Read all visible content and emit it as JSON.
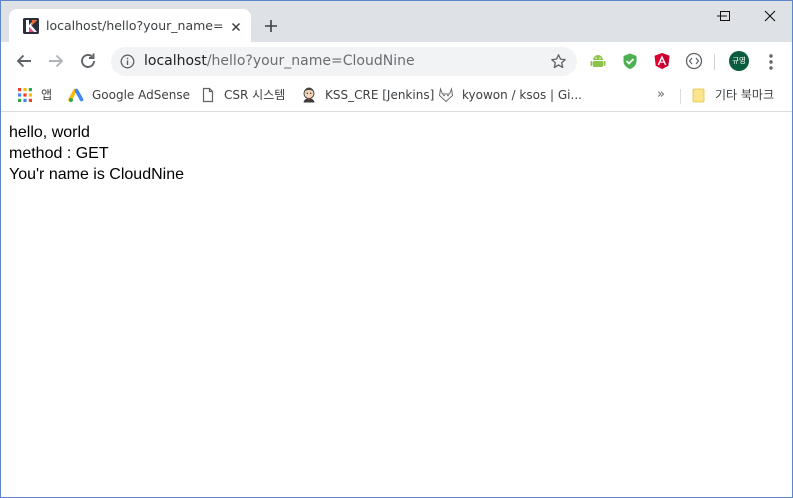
{
  "tab": {
    "title": "localhost/hello?your_name=CloudNine",
    "favicon": "kotlin-k-favicon"
  },
  "toolbar": {
    "url_host": "localhost",
    "url_path": "/hello?your_name=CloudNine",
    "profile_initials": "규영"
  },
  "bookmarks": {
    "items": [
      {
        "label": "앱",
        "icon": "apps-grid-icon"
      },
      {
        "label": "Google AdSense",
        "icon": "adsense-icon"
      },
      {
        "label": "CSR 시스템",
        "icon": "page-icon"
      },
      {
        "label": "KSS_CRE [Jenkins]",
        "icon": "jenkins-icon"
      },
      {
        "label": "kyowon / ksos | Gi...",
        "icon": "gitlab-icon"
      }
    ],
    "more": "»",
    "other": {
      "label": "기타 북마크",
      "icon": "folder-icon"
    }
  },
  "page": {
    "lines": [
      "hello, world",
      "method : GET",
      "You'r name is CloudNine"
    ]
  },
  "colors": {
    "tabstrip": "#dee1e6",
    "window_border": "#5b86c7",
    "omnibox": "#f1f3f4",
    "avatar": "#0a5c3e"
  }
}
